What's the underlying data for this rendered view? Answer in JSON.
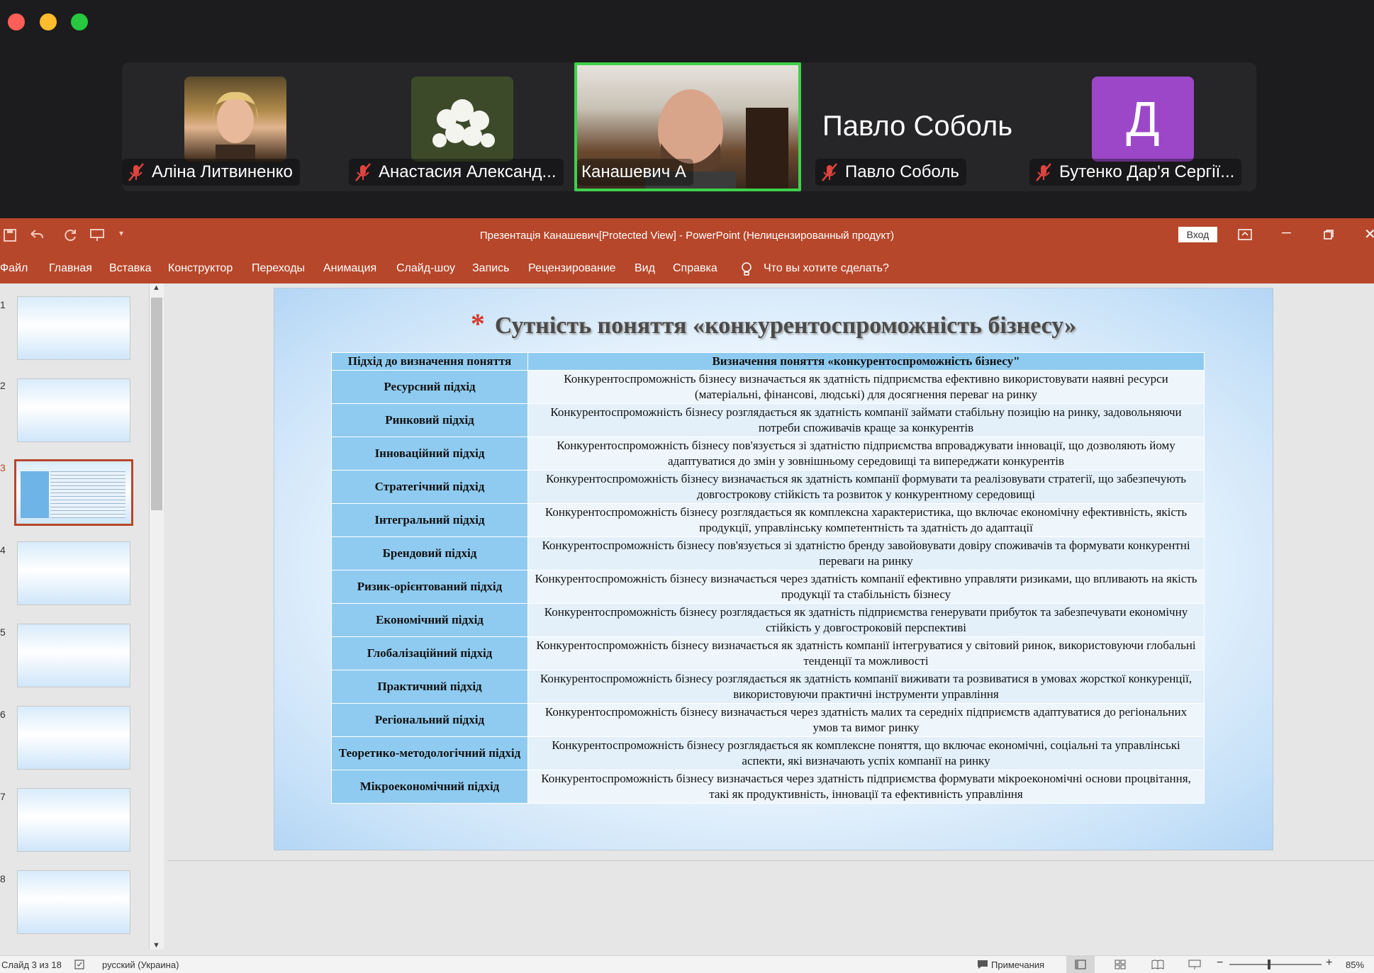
{
  "window": {
    "controls": [
      "close",
      "minimize",
      "zoom"
    ]
  },
  "participants": [
    {
      "name": "Аліна Литвиненко",
      "muted": true
    },
    {
      "name": "Анастасия Александ...",
      "muted": true
    },
    {
      "name": "Канашевич А",
      "muted": false,
      "active_speaker": true
    },
    {
      "name": "Павло Соболь",
      "muted": true,
      "display_name": "Павло Соболь"
    },
    {
      "name": "Бутенко Дар'я Сергії...",
      "muted": true,
      "avatar_letter": "Д"
    }
  ],
  "ppt": {
    "title": "Презентація Канашевич[Protected View]  -  PowerPoint (Нелицензированный продукт)",
    "signin": "Вход",
    "tabs": [
      "Файл",
      "Главная",
      "Вставка",
      "Конструктор",
      "Переходы",
      "Анимация",
      "Слайд-шоу",
      "Запись",
      "Рецензирование",
      "Вид",
      "Справка"
    ],
    "search_placeholder": "Что вы хотите сделать?",
    "thumbnails": [
      "1",
      "2",
      "3",
      "4",
      "5",
      "6",
      "7",
      "8"
    ],
    "status": {
      "slide": "Слайд 3 из 18",
      "language": "русский (Украина)",
      "notes": "Примечания",
      "zoom": "85%"
    }
  },
  "slide": {
    "title": "Сутність поняття «конкурентоспроможність бізнесу»",
    "table": {
      "headers": [
        "Підхід до визначення поняття",
        "Визначення поняття «конкурентоспроможність бізнесу\""
      ],
      "rows": [
        [
          "Ресурсний підхід",
          "Конкурентоспроможність бізнесу визначається як здатність підприємства ефективно використовувати наявні ресурси (матеріальні, фінансові, людські) для досягнення переваг на ринку"
        ],
        [
          "Ринковий підхід",
          "Конкурентоспроможність бізнесу розглядається як здатність компанії займати стабільну позицію на ринку, задовольняючи потреби споживачів краще за конкурентів"
        ],
        [
          "Інноваційний підхід",
          "Конкурентоспроможність бізнесу пов'язується зі здатністю підприємства впроваджувати інновації, що дозволяють йому адаптуватися до змін у зовнішньому середовищі та випереджати конкурентів"
        ],
        [
          "Стратегічний підхід",
          "Конкурентоспроможність бізнесу визначається як здатність компанії формувати та реалізовувати стратегії, що забезпечують довгострокову стійкість та розвиток у конкурентному середовищі"
        ],
        [
          "Інтегральний підхід",
          "Конкурентоспроможність бізнесу розглядається як комплексна характеристика, що включає економічну ефективність, якість продукції, управлінську компетентність та здатність до адаптації"
        ],
        [
          "Брендовий підхід",
          "Конкурентоспроможність бізнесу пов'язується зі здатністю бренду завойовувати довіру споживачів та формувати конкурентні переваги на ринку"
        ],
        [
          "Ризик-орієнтований підхід",
          "Конкурентоспроможність бізнесу визначається через здатність компанії ефективно управляти ризиками, що впливають на якість продукції та стабільність бізнесу"
        ],
        [
          "Економічний підхід",
          "Конкурентоспроможність бізнесу розглядається як здатність підприємства генерувати прибуток та забезпечувати економічну стійкість у довгостроковій перспективі"
        ],
        [
          "Глобалізаційний підхід",
          "Конкурентоспроможність бізнесу визначається як здатність компанії інтегруватися у світовий ринок, використовуючи глобальні тенденції та можливості"
        ],
        [
          "Практичний підхід",
          "Конкурентоспроможність бізнесу розглядається як здатність компанії виживати та розвиватися в умовах жорсткої конкуренції, використовуючи практичні інструменти управління"
        ],
        [
          "Регіональний підхід",
          "Конкурентоспроможність бізнесу визначається через здатність малих та середніх підприємств адаптуватися до регіональних умов та вимог ринку"
        ],
        [
          "Теоретико-методологічний підхід",
          "Конкурентоспроможність бізнесу розглядається як комплексне поняття, що включає економічні, соціальні та управлінські аспекти, які визначають успіх компанії на ринку"
        ],
        [
          "Мікроекономічний підхід",
          "Конкурентоспроможність бізнесу визначається через здатність підприємства формувати мікроекономічні основи процвітання, такі як продуктивність, інновації та ефективність управління"
        ]
      ]
    }
  }
}
